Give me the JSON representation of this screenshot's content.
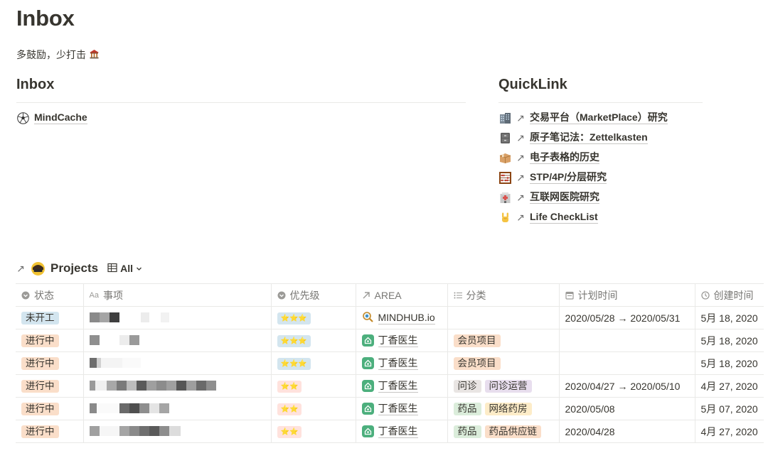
{
  "page": {
    "title": "Inbox",
    "subtitle": "多鼓励，少打击",
    "subtitle_icon": "temple-icon"
  },
  "inbox": {
    "heading": "Inbox",
    "items": [
      {
        "label": "MindCache",
        "icon": "soccer-ball-icon"
      }
    ]
  },
  "quicklink": {
    "heading": "QuickLink",
    "items": [
      {
        "label": "交易平台（MarketPlace）研究",
        "icon": "building-icon"
      },
      {
        "label": "原子笔记法：Zettelkasten",
        "icon": "file-cabinet-icon"
      },
      {
        "label": "电子表格的历史",
        "icon": "package-icon"
      },
      {
        "label": "STP/4P/分层研究",
        "icon": "abacus-icon"
      },
      {
        "label": "互联网医院研究",
        "icon": "hospital-icon"
      },
      {
        "label": "Life CheckList",
        "icon": "rock-hand-icon"
      }
    ]
  },
  "projects": {
    "title": "Projects",
    "view_label": "All",
    "columns": [
      {
        "label": "状态",
        "icon": "select-icon"
      },
      {
        "label": "事项",
        "icon": "title-icon"
      },
      {
        "label": "优先级",
        "icon": "select-icon"
      },
      {
        "label": "AREA",
        "icon": "relation-icon"
      },
      {
        "label": "分类",
        "icon": "multi-select-icon"
      },
      {
        "label": "计划时间",
        "icon": "calendar-icon"
      },
      {
        "label": "创建时间",
        "icon": "clock-icon"
      }
    ],
    "rows": [
      {
        "status": "未开工",
        "priority": "⭐⭐⭐",
        "area": "MINDHUB.io",
        "categories": [],
        "plan": "2020/05/28 → 2020/05/31",
        "created": "5月 18, 2020"
      },
      {
        "status": "进行中",
        "priority": "⭐⭐⭐",
        "area": "丁香医生",
        "categories": [
          "会员项目"
        ],
        "plan": "",
        "created": "5月 18, 2020"
      },
      {
        "status": "进行中",
        "priority": "⭐⭐⭐",
        "area": "丁香医生",
        "categories": [
          "会员项目"
        ],
        "plan": "",
        "created": "5月 18, 2020"
      },
      {
        "status": "进行中",
        "priority": "⭐⭐",
        "area": "丁香医生",
        "categories": [
          "问诊",
          "问诊运营"
        ],
        "plan": "2020/04/27 → 2020/05/10",
        "created": "4月 27, 2020"
      },
      {
        "status": "进行中",
        "priority": "⭐⭐",
        "area": "丁香医生",
        "categories": [
          "药品",
          "网络药房"
        ],
        "plan": "2020/05/08",
        "created": "5月 07, 2020"
      },
      {
        "status": "进行中",
        "priority": "⭐⭐",
        "area": "丁香医生",
        "categories": [
          "药品",
          "药品供应链"
        ],
        "plan": "2020/04/28",
        "created": "4月 27, 2020"
      }
    ]
  },
  "colors": {
    "text": "#37352f",
    "muted": "#787774",
    "border": "#e9e9e7",
    "tag_blue": "#d3e5ef",
    "tag_orange": "#fadec9",
    "tag_red": "#ffe2dd",
    "area_green": "#4caf7d"
  }
}
